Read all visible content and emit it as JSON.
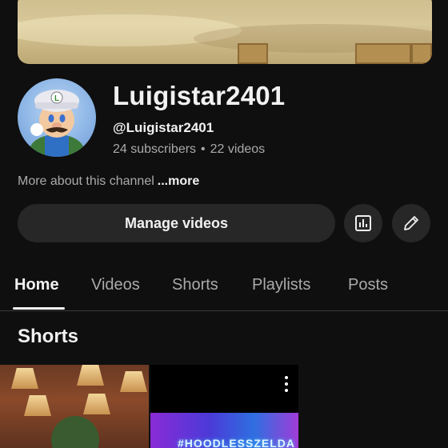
{
  "channel": {
    "name": "Luigistar2401",
    "handle": "@Luigistar2401",
    "subscribers": "24 subscribers",
    "separator": "•",
    "videos": "22 videos",
    "about_text": "More about this channel",
    "about_more": "...more"
  },
  "actions": {
    "manage_label": "Manage videos",
    "analytics_icon": "analytics-icon",
    "edit_icon": "pencil-icon"
  },
  "tabs": [
    {
      "label": "Home",
      "active": true
    },
    {
      "label": "Videos",
      "active": false
    },
    {
      "label": "Shorts",
      "active": false
    },
    {
      "label": "Playlists",
      "active": false
    },
    {
      "label": "Posts",
      "active": false
    }
  ],
  "sections": {
    "shorts_title": "Shorts"
  },
  "shorts": [
    {
      "thumb": "palace-lamps"
    },
    {
      "thumb": "neon",
      "overlay_text": "#HOODLESSZELDA",
      "menu_icon": "more-vert-icon"
    }
  ],
  "colors": {
    "background": "#0f0f0f",
    "button_bg": "#272727",
    "text_primary": "#f1f1f1",
    "text_secondary": "#aaaaaa"
  }
}
